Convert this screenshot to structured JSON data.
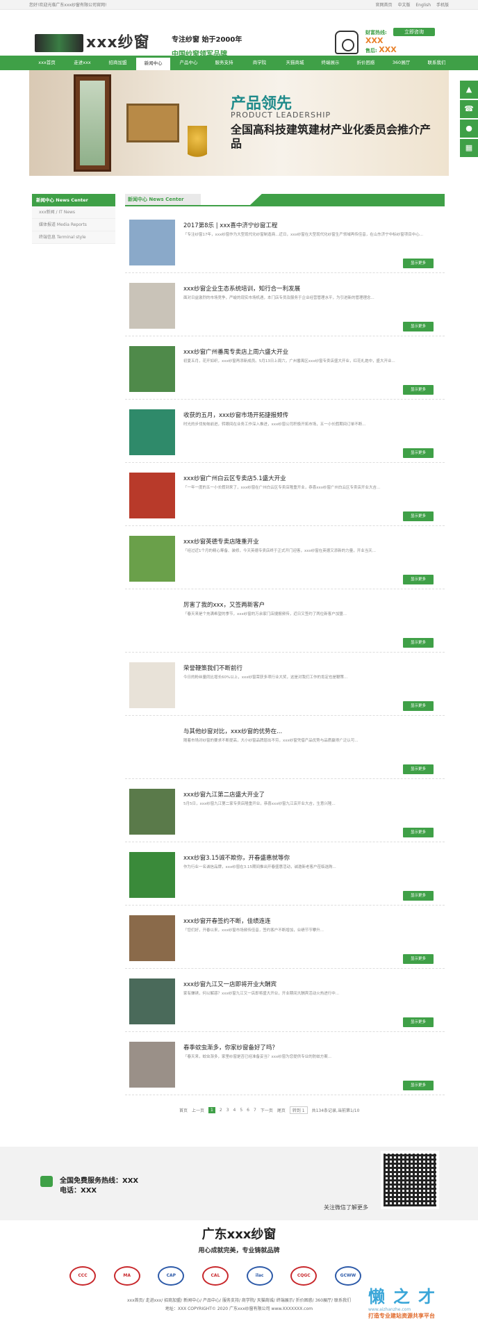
{
  "topbar": {
    "welcome": "您好!欢迎光临广东xxx纱窗有限公司官网!",
    "links": [
      "官网首页",
      "中文版",
      "English",
      "手机版"
    ]
  },
  "header": {
    "logo_text": "xxx纱窗",
    "slogan1": "专注纱窗 始于2000年",
    "slogan2": "中国纱窗领军品牌",
    "hotline_label": "财富热线:",
    "hotline_num": "XXX",
    "after_sales_label": "售后:",
    "after_sales_num": "XXX",
    "online_btn": "立即咨询"
  },
  "nav": [
    "xxx首页",
    "走进xxx",
    "招商加盟",
    "新闻中心",
    "产品中心",
    "服务支持",
    "商学院",
    "天猫商城",
    "终端展示",
    "折价困惑",
    "360展厅",
    "联系我们"
  ],
  "nav_active_index": 3,
  "banner": {
    "h1": "产品领先",
    "h2": "PRODUCT LEADERSHIP",
    "h3": "全国高科技建筑建材产业化委员会推介产品"
  },
  "side_tools": [
    "top-icon",
    "phone-icon",
    "qq-icon",
    "qr-icon"
  ],
  "sidebar": {
    "title": "新闻中心 News Center",
    "items": [
      "xxx新闻 / IT News",
      "媒体报道 Media Reports",
      "终端信息 Terminal style"
    ]
  },
  "main_head": "新闻中心 News Center",
  "news": [
    {
      "title": "2017第8乐 | xxx喜中济宁纱窗工程",
      "desc": "「专注纱窗17年，xxx纱窗作为大型现代化纱窗制造商...近日，xxx纱窗在大型现代化纱窗生产领域再传佳音，在山东济宁中标纱窗项目中心...",
      "more": "显示更多",
      "thumb": "#8aa9c9"
    },
    {
      "title": "xxx纱窗企业生态系统培训，知行合一利发展",
      "desc": "面对日益激烈的市场竞争，严峻的现实市场机遇，本门店专员及服务于企业经营管理水平，为引进新的管理理念...",
      "more": "显示更多",
      "thumb": "#c9c3b8"
    },
    {
      "title": "xxx纱窗广州番禺专卖店上周六盛大开业",
      "desc": "初夏五月，花开如织，xxx纱窗再添新成员。5月13日上周六，广州番禺区xxx纱窗专卖店盛大开业，红花礼炮中，盛大开业...",
      "more": "显示更多",
      "thumb": "#4f8a4a"
    },
    {
      "title": "收获的五月，xxx纱窗市场开拓捷报频传",
      "desc": "时光的步伐匆匆前进，转眼间在业务工作深入推进，xxx纱窗公司积极开拓市场，五一小长假期间订单不断...",
      "more": "显示更多",
      "thumb": "#2f8a6a"
    },
    {
      "title": "xxx纱窗广州白云区专卖店5.1盛大开业",
      "desc": "「一年一度的五一小长假到来了，xxx纱窗在广州白云区专卖店隆重开业，恭喜xxx纱窗广州白云区专卖店开业大吉...",
      "more": "显示更多",
      "thumb": "#b83a2a"
    },
    {
      "title": "xxx纱窗英德专卖店隆重开业",
      "desc": "「经过近1个月的精心筹备、装修，今天英德专卖店终于正式开门迎客，xxx纱窗在英德又添新的力量，开业当天...",
      "more": "显示更多",
      "thumb": "#6aa04a"
    },
    {
      "title": "厉害了我的xxx，又签两新客户",
      "desc": "「春天来是个充满希望的季节，xxx纱窗的万余家门店捷报频传，近日又签约了两位新客户加盟...",
      "more": "显示更多",
      "thumb": "#ffffff"
    },
    {
      "title": "荣誉鞭策我们不断前行",
      "desc": "今日的粉丝量同比增长60%以上，xxx纱窗荣获多项行业大奖，这是对我们工作的肯定也是鞭策...",
      "more": "显示更多",
      "thumb": "#e8e2d8"
    },
    {
      "title": "与其他纱窗对比，xxx纱窗的优势在...",
      "desc": "随着市场对纱窗的要求不断提高，大小纱窗品牌层出不穷，xxx纱窗凭借产品优势与品质赢得广泛认可...",
      "more": "显示更多",
      "thumb": "#ffffff"
    },
    {
      "title": "xxx纱窗九江第二店盛大开业了",
      "desc": "5月5日，xxx纱窗九江第二家专卖店隆重开业，恭喜xxx纱窗九江店开业大吉，生意兴隆...",
      "more": "显示更多",
      "thumb": "#5a7a4a"
    },
    {
      "title": "xxx纱窗3.15诚不欺你，开春盛惠就等你",
      "desc": "作为行业一名诚信品牌，xxx纱窗在3.15期间推出开春盛惠活动，诚邀新老客户莅临选购...",
      "more": "显示更多",
      "thumb": "#3a8a3a"
    },
    {
      "title": "xxx纱窗开春签约不断，佳绩连连",
      "desc": "「您们好，开春以来，xxx纱窗市场频传佳音，签约客户不断增加，业绩节节攀升...",
      "more": "显示更多",
      "thumb": "#8a6a4a"
    },
    {
      "title": "xxx纱窗九江又一店即将开业大酬宾",
      "desc": "家有嫌锈，何以解惑？xxx纱窗九江又一店即将盛大开业，开业期间大酬宾活动火热进行中...",
      "more": "显示更多",
      "thumb": "#4a6a5a"
    },
    {
      "title": "春季蚊虫渐多，你家纱窗备好了吗？",
      "desc": "「春天来，蚊虫渐多，家里纱窗是否已经准备妥当？xxx纱窗为您提供专业的防蚊方案...",
      "more": "显示更多",
      "thumb": "#9a9088"
    }
  ],
  "pager": {
    "first": "首页",
    "prev": "上一页",
    "pages": [
      "1",
      "2",
      "3",
      "4",
      "5",
      "6",
      "7"
    ],
    "next": "下一页",
    "last": "尾页",
    "goto": "转到 1",
    "summary": "共134条记录,当前第1/10"
  },
  "contact": {
    "line1": "全国免费服务热线：XXX",
    "line2": "电话：XXX",
    "qr_caption": "关注微信了解更多"
  },
  "footer": {
    "brand": "广东xxx纱窗",
    "tagline": "用心成就完美，专业铸就品牌",
    "certs": [
      "CCC",
      "MA",
      "CAP",
      "CAL",
      "ilac",
      "CQGC",
      "GCWW"
    ],
    "links": "xxx首页/ 走进xxx/ 招商加盟/ 新闻中心/ 产品中心/ 服务支持/ 商学院/ 天猫商城/ 终端展示/ 折价困惑/ 360展厅/ 联系我们",
    "copyright": "地址：XXX COPYRIGHT© 2020 广东xxx纱窗有限公司 www.XXXXXXX.com"
  },
  "watermark": {
    "w1": "懒之才",
    "w2": "www.aizhanzhe.com",
    "w3": "打造专业建站资源共享平台"
  }
}
